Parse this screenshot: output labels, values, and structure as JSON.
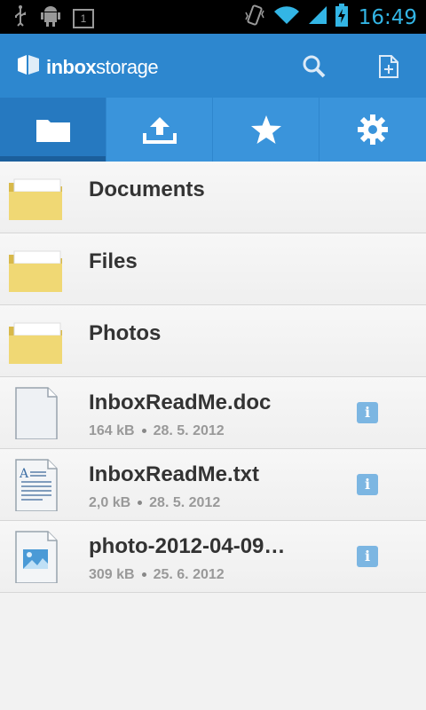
{
  "status_bar": {
    "time": "16:49",
    "notification_count": "1",
    "icons": [
      "usb-icon",
      "android-debug-icon",
      "notification-icon",
      "vibrate-icon",
      "wifi-icon",
      "signal-icon",
      "battery-charging-icon"
    ]
  },
  "app": {
    "logo_bold": "inbox",
    "logo_rest": "storage",
    "actions": [
      "search-icon",
      "new-document-icon"
    ],
    "accent": "#2d87cf"
  },
  "tabs": [
    {
      "icon": "folder-icon",
      "active": true
    },
    {
      "icon": "upload-icon",
      "active": false
    },
    {
      "icon": "star-icon",
      "active": false
    },
    {
      "icon": "gear-icon",
      "active": false
    }
  ],
  "items": [
    {
      "type": "folder",
      "name": "Documents"
    },
    {
      "type": "folder",
      "name": "Files"
    },
    {
      "type": "folder",
      "name": "Photos"
    },
    {
      "type": "doc",
      "name": "InboxReadMe.doc",
      "size": "164 kB",
      "date": "28. 5. 2012"
    },
    {
      "type": "txt",
      "name": "InboxReadMe.txt",
      "size": "2,0 kB",
      "date": "28. 5. 2012"
    },
    {
      "type": "image",
      "name": "photo-2012-04-09…",
      "size": "309 kB",
      "date": "25. 6. 2012"
    }
  ],
  "info_label": "i"
}
